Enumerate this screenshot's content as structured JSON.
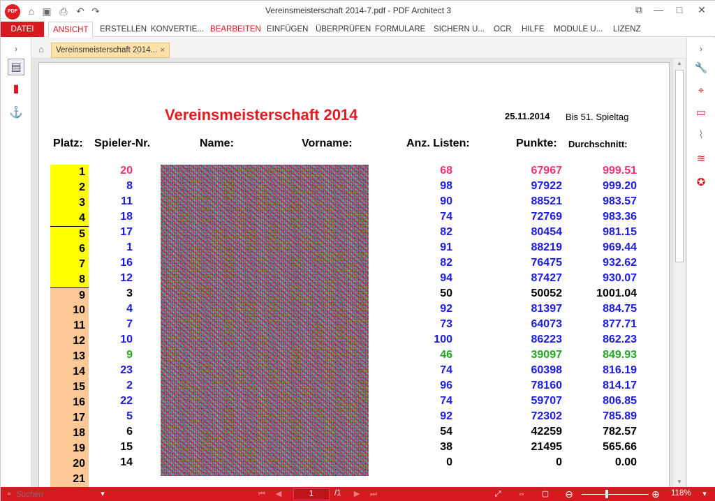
{
  "window": {
    "title": "Vereinsmeisterschaft 2014-7.pdf    -    PDF Architect 3",
    "app_logo": "PDF"
  },
  "ribbon": {
    "file_tab": "DATEI",
    "tabs": [
      "ANSICHT",
      "ERSTELLEN",
      "KONVERTIE...",
      "BEARBEITEN",
      "EINFÜGEN",
      "ÜBERPRÜFEN",
      "FORMULARE",
      "SICHERN U...",
      "OCR",
      "HILFE",
      "MODULE U...",
      "LIZENZ"
    ],
    "active_tab": "ANSICHT"
  },
  "document_tab": {
    "label": "Vereinsmeisterschaft 2014...",
    "close": "×"
  },
  "document": {
    "title": "Vereinsmeisterschaft 2014",
    "date": "25.11.2014",
    "spieltag": "Bis 51. Spieltag",
    "headers": {
      "platz": "Platz:",
      "spieler": "Spieler-Nr.",
      "name": "Name:",
      "vorname": "Vorname:",
      "listen": "Anz. Listen:",
      "punkte": "Punkte:",
      "schnitt": "Durchschnitt:"
    },
    "rows": [
      {
        "platz": "1",
        "spieler": "20",
        "listen": "68",
        "punkte": "67967",
        "schnitt": "999.51"
      },
      {
        "platz": "2",
        "spieler": "8",
        "listen": "98",
        "punkte": "97922",
        "schnitt": "999.20"
      },
      {
        "platz": "3",
        "spieler": "11",
        "listen": "90",
        "punkte": "88521",
        "schnitt": "983.57"
      },
      {
        "platz": "4",
        "spieler": "18",
        "listen": "74",
        "punkte": "72769",
        "schnitt": "983.36"
      },
      {
        "platz": "5",
        "spieler": "17",
        "listen": "82",
        "punkte": "80454",
        "schnitt": "981.15"
      },
      {
        "platz": "6",
        "spieler": "1",
        "listen": "91",
        "punkte": "88219",
        "schnitt": "969.44"
      },
      {
        "platz": "7",
        "spieler": "16",
        "listen": "82",
        "punkte": "76475",
        "schnitt": "932.62"
      },
      {
        "platz": "8",
        "spieler": "12",
        "listen": "94",
        "punkte": "87427",
        "schnitt": "930.07"
      },
      {
        "platz": "9",
        "spieler": "3",
        "listen": "50",
        "punkte": "50052",
        "schnitt": "1001.04"
      },
      {
        "platz": "10",
        "spieler": "4",
        "listen": "92",
        "punkte": "81397",
        "schnitt": "884.75"
      },
      {
        "platz": "11",
        "spieler": "7",
        "listen": "73",
        "punkte": "64073",
        "schnitt": "877.71"
      },
      {
        "platz": "12",
        "spieler": "10",
        "listen": "100",
        "punkte": "86223",
        "schnitt": "862.23"
      },
      {
        "platz": "13",
        "spieler": "9",
        "listen": "46",
        "punkte": "39097",
        "schnitt": "849.93"
      },
      {
        "platz": "14",
        "spieler": "23",
        "listen": "74",
        "punkte": "60398",
        "schnitt": "816.19"
      },
      {
        "platz": "15",
        "spieler": "2",
        "listen": "96",
        "punkte": "78160",
        "schnitt": "814.17"
      },
      {
        "platz": "16",
        "spieler": "22",
        "listen": "74",
        "punkte": "59707",
        "schnitt": "806.85"
      },
      {
        "platz": "17",
        "spieler": "5",
        "listen": "92",
        "punkte": "72302",
        "schnitt": "785.89"
      },
      {
        "platz": "18",
        "spieler": "6",
        "listen": "54",
        "punkte": "42259",
        "schnitt": "782.57"
      },
      {
        "platz": "19",
        "spieler": "15",
        "listen": "38",
        "punkte": "21495",
        "schnitt": "565.66"
      },
      {
        "platz": "20",
        "spieler": "14",
        "listen": "0",
        "punkte": "0",
        "schnitt": "0.00"
      },
      {
        "platz": "21",
        "spieler": "",
        "listen": "",
        "punkte": "",
        "schnitt": ""
      }
    ]
  },
  "row_colors": [
    "#ff2d6f",
    "#1a1ae6",
    "#1a1ae6",
    "#1a1ae6",
    "#1a1ae6",
    "#1a1ae6",
    "#1a1ae6",
    "#1a1ae6",
    "#000000",
    "#1a1ae6",
    "#1a1ae6",
    "#1a1ae6",
    "#1fa81f",
    "#1a1ae6",
    "#1a1ae6",
    "#1a1ae6",
    "#1a1ae6",
    "#000000",
    "#000000",
    "#000000",
    "#000000"
  ],
  "colors": {
    "accent": "#d71920",
    "platz_top8": "#ffff00",
    "platz_rest": "#fcc896"
  },
  "statusbar": {
    "search_placeholder": "Suchen",
    "page_current": "1",
    "page_total": "/1",
    "zoom": "118%"
  }
}
